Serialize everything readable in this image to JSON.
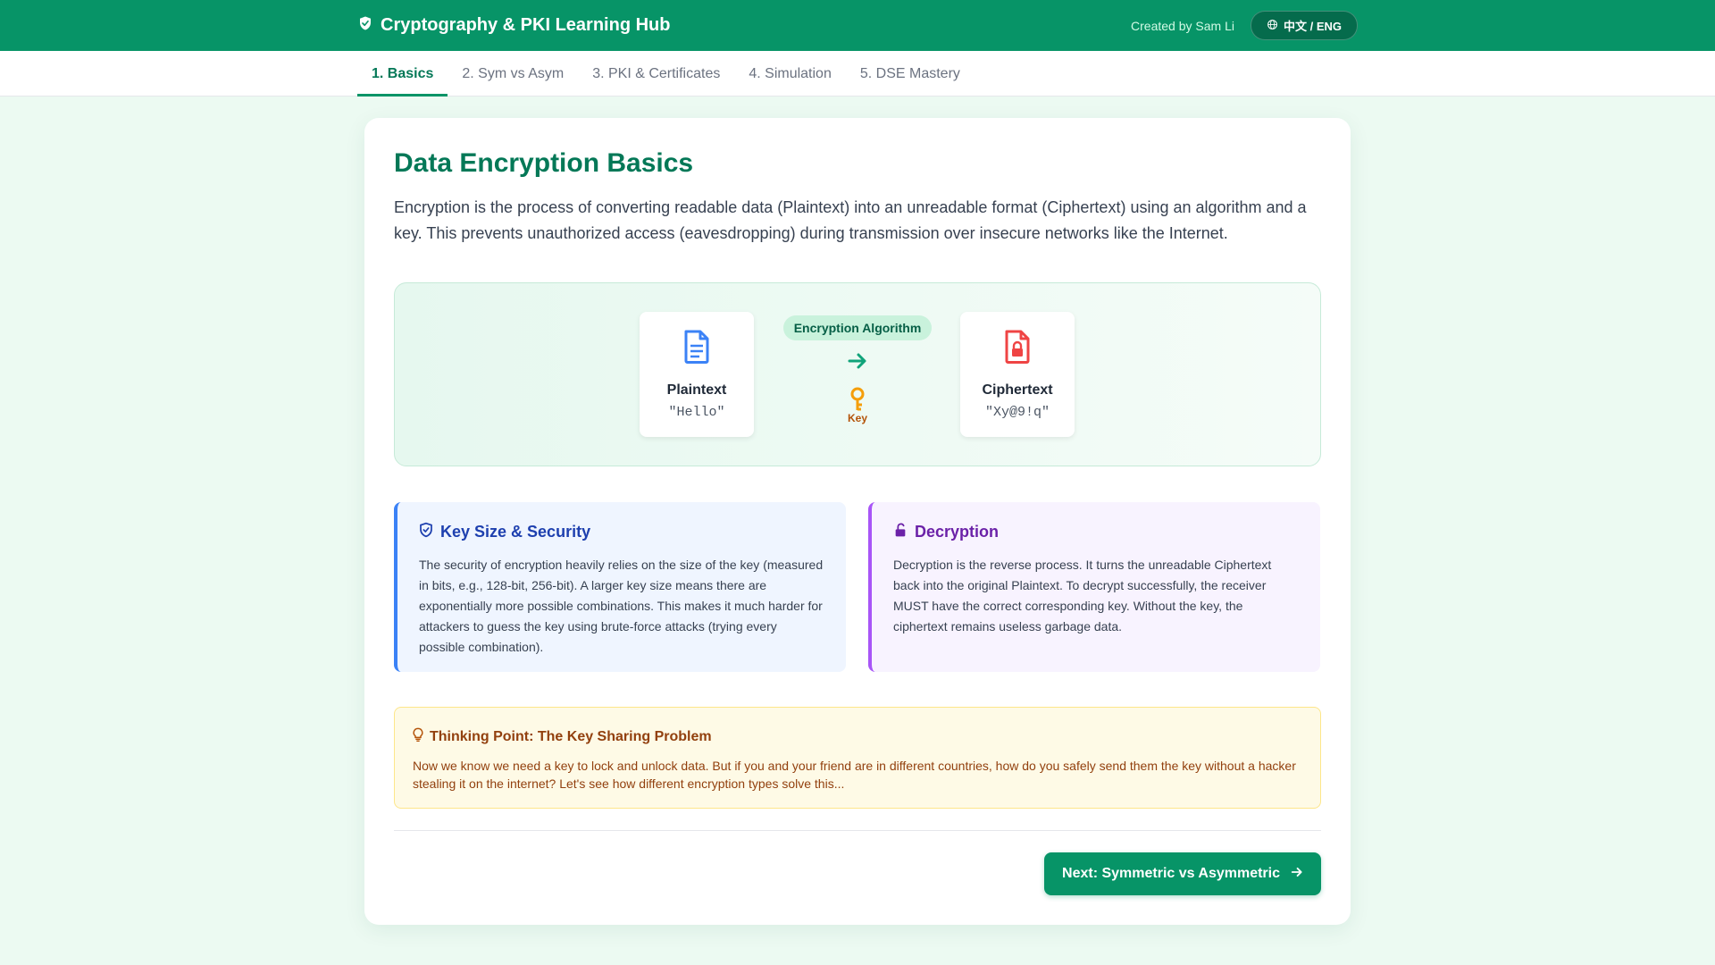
{
  "header": {
    "brand_icon": "shield-icon",
    "title": "Cryptography & PKI Learning Hub",
    "creator": "Created by Sam Li",
    "lang_icon": "globe-icon",
    "lang_label": "中文 / ENG"
  },
  "tabs": [
    {
      "label": "1. Basics",
      "active": true
    },
    {
      "label": "2. Sym vs Asym",
      "active": false
    },
    {
      "label": "3. PKI & Certificates",
      "active": false
    },
    {
      "label": "4. Simulation",
      "active": false
    },
    {
      "label": "5. DSE Mastery",
      "active": false
    }
  ],
  "main": {
    "title": "Data Encryption Basics",
    "intro": "Encryption is the process of converting readable data (Plaintext) into an unreadable format (Ciphertext) using an algorithm and a key. This prevents unauthorized access (eavesdropping) during transmission over insecure networks like the Internet."
  },
  "diagram": {
    "plaintext": {
      "icon": "document-icon",
      "label": "Plaintext",
      "value": "\"Hello\""
    },
    "algorithm": {
      "label": "Encryption Algorithm",
      "arrow_icon": "arrow-right-icon",
      "key_icon": "key-icon",
      "key_label": "Key"
    },
    "ciphertext": {
      "icon": "lock-file-icon",
      "label": "Ciphertext",
      "value": "\"Xy@9!q\""
    }
  },
  "info_boxes": {
    "key_size": {
      "icon": "shield-check-icon",
      "title": "Key Size & Security",
      "text": "The security of encryption heavily relies on the size of the key (measured in bits, e.g., 128-bit, 256-bit). A larger key size means there are exponentially more possible combinations. This makes it much harder for attackers to guess the key using brute-force attacks (trying every possible combination)."
    },
    "decryption": {
      "icon": "unlock-icon",
      "title": "Decryption",
      "text": "Decryption is the reverse process. It turns the unreadable Ciphertext back into the original Plaintext. To decrypt successfully, the receiver MUST have the correct corresponding key. Without the key, the ciphertext remains useless garbage data."
    }
  },
  "thinking": {
    "icon": "lightbulb-icon",
    "title": "Thinking Point: The Key Sharing Problem",
    "text": "Now we know we need a key to lock and unlock data. But if you and your friend are in different countries, how do you safely send them the key without a hacker stealing it on the internet? Let's see how different encryption types solve this..."
  },
  "next_button": {
    "label": "Next: Symmetric vs Asymmetric",
    "icon": "arrow-right-icon"
  },
  "colors": {
    "brand": "#079467",
    "brand_dark": "#047857",
    "blue_accent": "#3b82f6",
    "purple_accent": "#a855f7",
    "amber_accent": "#b45309",
    "ciphertext_red": "#ef4444"
  }
}
